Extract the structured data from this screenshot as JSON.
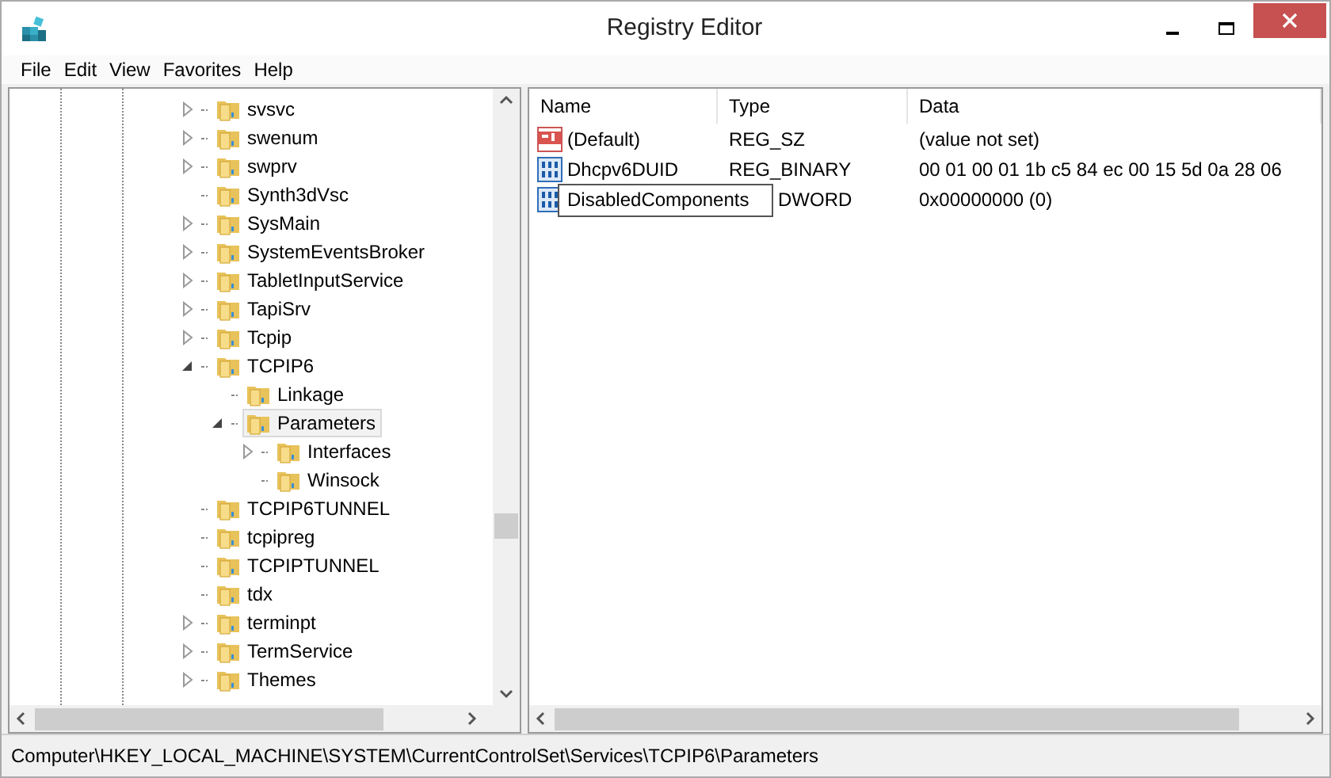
{
  "window": {
    "title": "Registry Editor"
  },
  "menu": [
    "File",
    "Edit",
    "View",
    "Favorites",
    "Help"
  ],
  "tree": [
    {
      "label": "svsvc",
      "kind": "collapsed",
      "selected": false
    },
    {
      "label": "swenum",
      "kind": "collapsed",
      "selected": false
    },
    {
      "label": "swprv",
      "kind": "collapsed",
      "selected": false
    },
    {
      "label": "Synth3dVsc",
      "kind": "leaf",
      "selected": false
    },
    {
      "label": "SysMain",
      "kind": "collapsed",
      "selected": false
    },
    {
      "label": "SystemEventsBroker",
      "kind": "collapsed",
      "selected": false
    },
    {
      "label": "TabletInputService",
      "kind": "collapsed",
      "selected": false
    },
    {
      "label": "TapiSrv",
      "kind": "collapsed",
      "selected": false
    },
    {
      "label": "Tcpip",
      "kind": "collapsed",
      "selected": false
    },
    {
      "label": "TCPIP6",
      "kind": "expanded",
      "selected": false,
      "children": [
        {
          "label": "Linkage",
          "kind": "leaf",
          "selected": false
        },
        {
          "label": "Parameters",
          "kind": "expanded",
          "selected": true,
          "children": [
            {
              "label": "Interfaces",
              "kind": "collapsed",
              "selected": false
            },
            {
              "label": "Winsock",
              "kind": "leaf",
              "selected": false
            }
          ]
        }
      ]
    },
    {
      "label": "TCPIP6TUNNEL",
      "kind": "leaf",
      "selected": false
    },
    {
      "label": "tcpipreg",
      "kind": "leaf",
      "selected": false
    },
    {
      "label": "TCPIPTUNNEL",
      "kind": "leaf",
      "selected": false
    },
    {
      "label": "tdx",
      "kind": "leaf",
      "selected": false
    },
    {
      "label": "terminpt",
      "kind": "collapsed",
      "selected": false
    },
    {
      "label": "TermService",
      "kind": "collapsed",
      "selected": false
    },
    {
      "label": "Themes",
      "kind": "collapsed",
      "selected": false
    }
  ],
  "table": {
    "columns": [
      "Name",
      "Type",
      "Data"
    ],
    "rows": [
      {
        "kind": "string",
        "name": "(Default)",
        "type": "REG_SZ",
        "data": "(value not set)",
        "editing": false
      },
      {
        "kind": "binary",
        "name": "Dhcpv6DUID",
        "type": "REG_BINARY",
        "data": "00 01 00 01 1b c5 84 ec 00 15 5d 0a 28 06",
        "editing": false
      },
      {
        "kind": "binary",
        "name": "DisabledComponents",
        "type": "DWORD",
        "data": "0x00000000 (0)",
        "editing": true
      }
    ]
  },
  "status_bar": "Computer\\HKEY_LOCAL_MACHINE\\SYSTEM\\CurrentControlSet\\Services\\TCPIP6\\Parameters"
}
